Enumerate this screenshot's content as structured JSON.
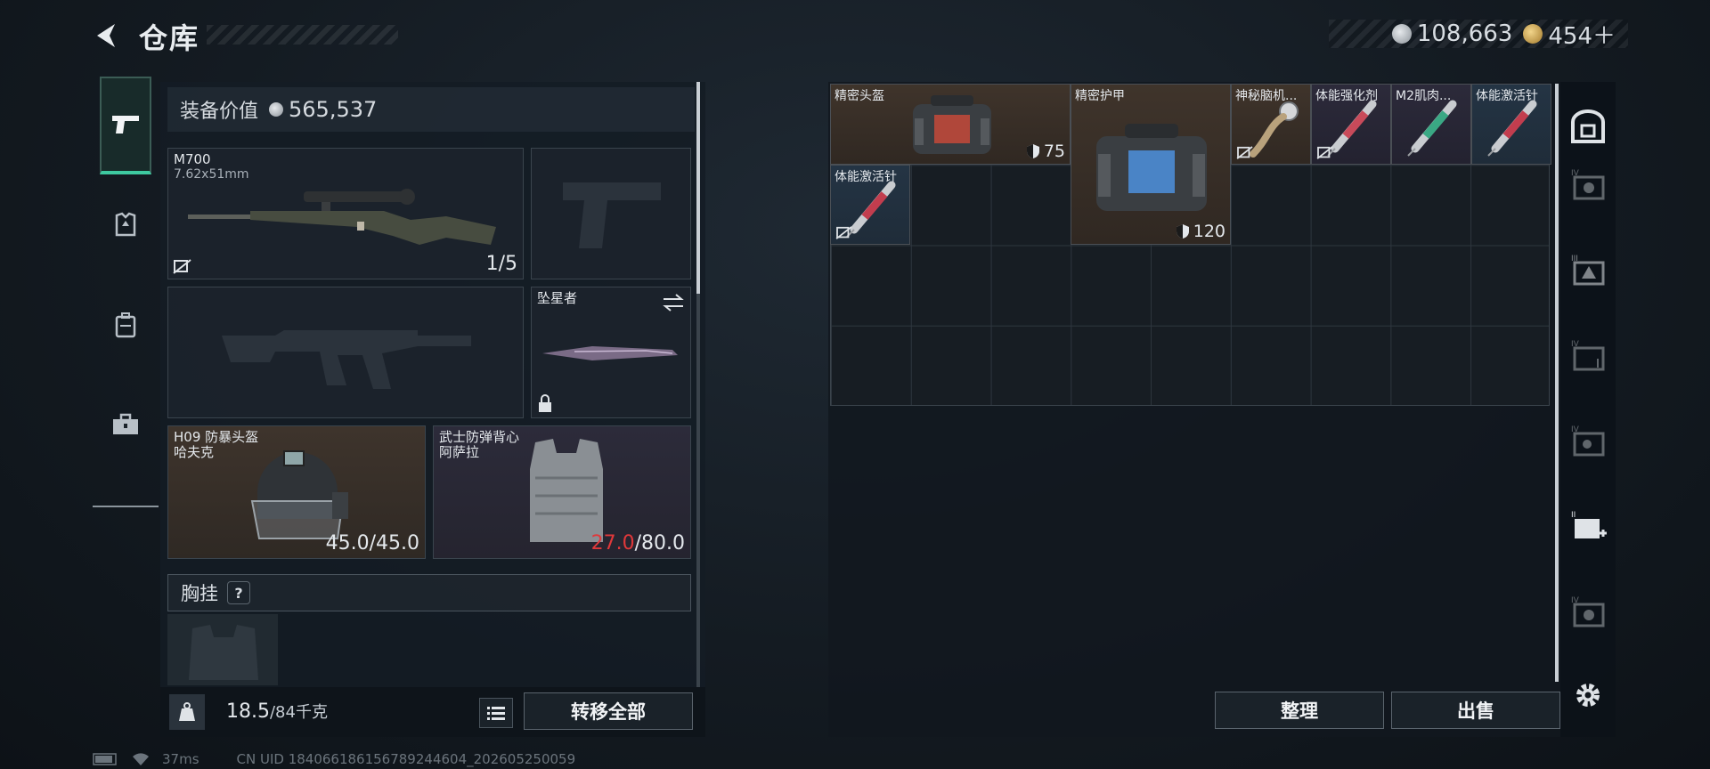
{
  "header": {
    "title": "仓库",
    "currency": [
      {
        "icon": "silver-coin-icon",
        "value": "108,663"
      },
      {
        "icon": "gold-coin-icon",
        "value": "454＋"
      }
    ]
  },
  "left_tabs": [
    {
      "icon": "pistol-icon",
      "active": true
    },
    {
      "icon": "armor-icon",
      "active": false
    },
    {
      "icon": "backpack-icon",
      "active": false
    },
    {
      "icon": "toolbox-icon",
      "active": false
    }
  ],
  "loadout": {
    "value_label": "装备价值",
    "value": "565,537",
    "primary": {
      "name": "M700",
      "ammo": "7.62x51mm",
      "count": "1/5"
    },
    "melee": {
      "name": "坠星者"
    },
    "helmet": {
      "name": "H09 防暴头盔",
      "brand": "哈夫克",
      "durability": "45.0/45.0"
    },
    "vest": {
      "name": "武士防弹背心",
      "brand": "阿萨拉",
      "durability_current": "27.0",
      "durability_max": "/80.0"
    },
    "chest_rig": {
      "label": "胸挂",
      "help": "?"
    },
    "weight": {
      "current": "18.5",
      "capacity": "/84千克"
    },
    "transfer_all": "转移全部"
  },
  "storage": {
    "items": [
      {
        "name": "精密头盔",
        "value": "75",
        "color": "brown"
      },
      {
        "name": "精密护甲",
        "value": "120",
        "color": "brown"
      },
      {
        "name": "神秘脑机...",
        "color": "brown"
      },
      {
        "name": "体能强化剂",
        "color": "purple"
      },
      {
        "name": "M2肌肉...",
        "color": "purple"
      },
      {
        "name": "体能激活针",
        "color": "blue"
      },
      {
        "name": "体能激活针",
        "color": "blue"
      }
    ],
    "sort_label": "整理",
    "sell_label": "出售"
  },
  "right_tabs": [
    {
      "icon": "safe-box-icon"
    },
    {
      "icon": "tier-iv-case-icon"
    },
    {
      "icon": "tier-iii-case-icon"
    },
    {
      "icon": "tier-iv-folder-icon"
    },
    {
      "icon": "tier-iv-device-icon"
    },
    {
      "icon": "tier-ii-medkit-icon"
    },
    {
      "icon": "tier-iv-box-icon"
    },
    {
      "icon": "settings-gear-icon"
    }
  ],
  "status": {
    "ping": "37ms",
    "uid": "CN UID 184066186156789244604_202605250059"
  }
}
